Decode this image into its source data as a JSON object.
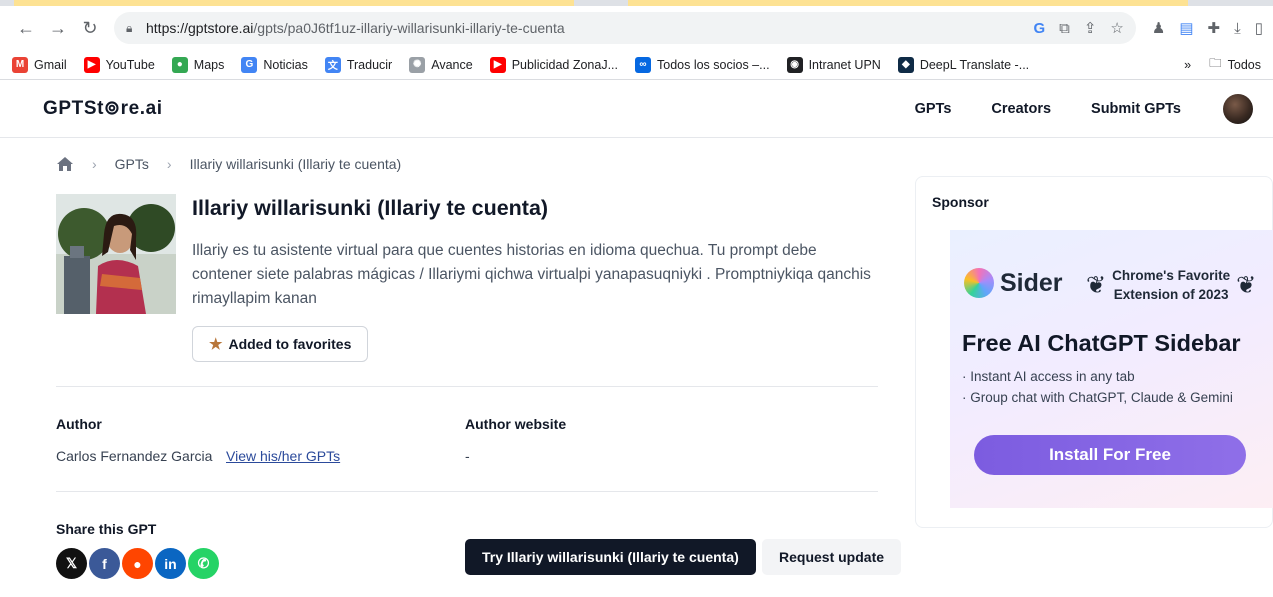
{
  "browser": {
    "url_host": "https://gptstore.ai",
    "url_path": "/gpts/pa0J6tf1uz-illariy-willarisunki-illariy-te-cuenta",
    "bookmarks": [
      {
        "label": "Gmail",
        "icon": "gmail-icon",
        "color": "#ea4335",
        "glyph": "M"
      },
      {
        "label": "YouTube",
        "icon": "youtube-icon",
        "color": "#ff0000",
        "glyph": "▶"
      },
      {
        "label": "Maps",
        "icon": "maps-icon",
        "color": "#34a853",
        "glyph": "●"
      },
      {
        "label": "Noticias",
        "icon": "news-icon",
        "color": "#4285f4",
        "glyph": "G"
      },
      {
        "label": "Traducir",
        "icon": "translate-icon",
        "color": "#4285f4",
        "glyph": "文"
      },
      {
        "label": "Avance",
        "icon": "avance-icon",
        "color": "#9aa0a6",
        "glyph": "✺"
      },
      {
        "label": "Publicidad ZonaJ...",
        "icon": "youtube-icon",
        "color": "#ff0000",
        "glyph": "▶"
      },
      {
        "label": "Todos los socios –...",
        "icon": "meta-icon",
        "color": "#0668e1",
        "glyph": "∞"
      },
      {
        "label": "Intranet UPN",
        "icon": "globe-icon",
        "color": "#202124",
        "glyph": "◉"
      },
      {
        "label": "DeepL Translate -...",
        "icon": "deepl-icon",
        "color": "#0f2b46",
        "glyph": "◆"
      }
    ],
    "overflow_label": "»",
    "all_bookmarks_label": "Todos"
  },
  "site": {
    "logo": "GPTSt⊚re.ai",
    "nav": [
      "GPTs",
      "Creators",
      "Submit GPTs"
    ]
  },
  "breadcrumb": {
    "items": [
      "GPTs",
      "Illariy willarisunki (Illariy te cuenta)"
    ]
  },
  "gpt": {
    "title": "Illariy willarisunki (Illariy te cuenta)",
    "description": "Illariy es tu asistente virtual para que cuentes historias en idioma quechua. Tu prompt debe contener siete palabras mágicas / Illariymi qichwa virtualpi yanapasuqniyki . Promptniykiqa qanchis rimayllapim kanan",
    "favorite_label": "Added to favorites",
    "author_label": "Author",
    "author_name": "Carlos Fernandez Garcia",
    "author_link": "View his/her GPTs",
    "website_label": "Author website",
    "website_value": "-",
    "share_label": "Share this GPT",
    "share": [
      {
        "name": "x-share-icon",
        "glyph": "𝕏",
        "color": "#111111"
      },
      {
        "name": "facebook-share-icon",
        "glyph": "f",
        "color": "#3b5998"
      },
      {
        "name": "reddit-share-icon",
        "glyph": "●",
        "color": "#ff4500"
      },
      {
        "name": "linkedin-share-icon",
        "glyph": "in",
        "color": "#0a66c2"
      },
      {
        "name": "whatsapp-share-icon",
        "glyph": "✆",
        "color": "#25d366"
      }
    ],
    "try_label": "Try Illariy willarisunki (Illariy te cuenta)",
    "request_label": "Request update"
  },
  "sponsor": {
    "title": "Sponsor",
    "brand": "Sider",
    "award_line1": "Chrome's Favorite",
    "award_line2": "Extension of 2023",
    "headline": "Free AI ChatGPT Sidebar",
    "bullet1": "· Instant AI access in any tab",
    "bullet2": "· Group chat with ChatGPT, Claude & Gemini",
    "cta": "Install For Free"
  }
}
